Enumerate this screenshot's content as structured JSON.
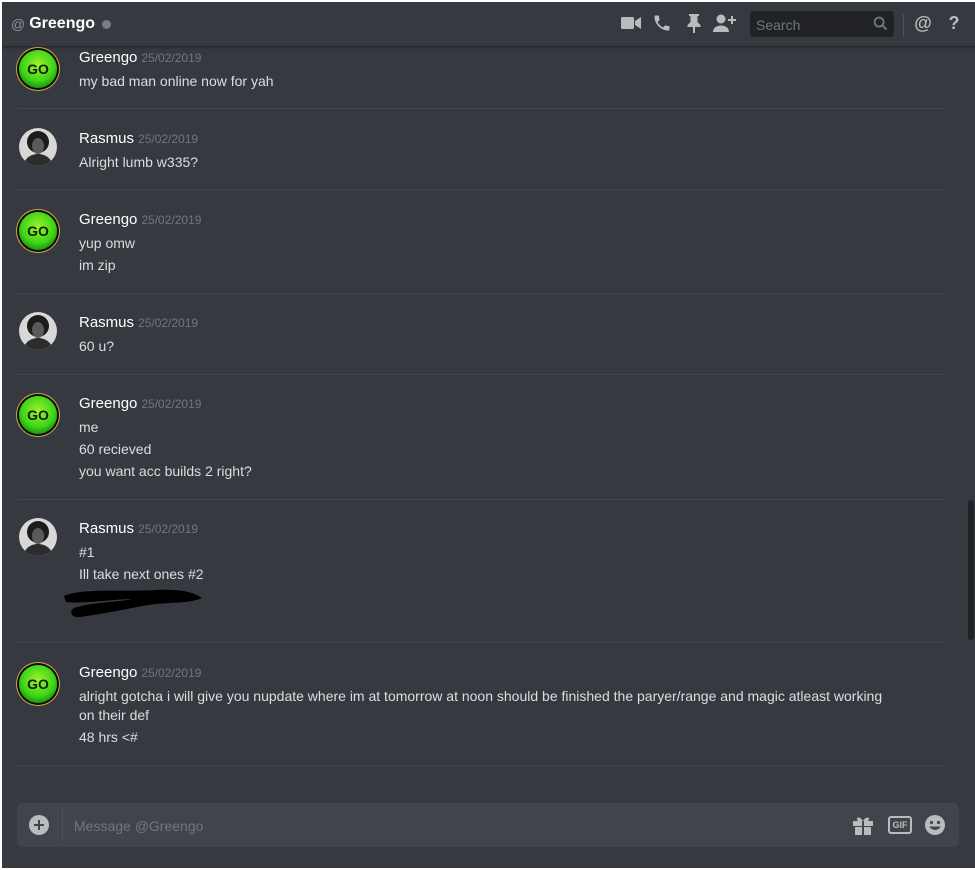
{
  "header": {
    "at": "@",
    "title": "Greengo",
    "search_placeholder": "Search",
    "mention_label": "@",
    "help_label": "?"
  },
  "messages": [
    {
      "author": "Greengo",
      "timestamp": "25/02/2019",
      "avatar": "go-icon",
      "avatar_text": "GO",
      "lines": [
        "my bad man online now for yah"
      ]
    },
    {
      "author": "Rasmus",
      "timestamp": "25/02/2019",
      "avatar": "portrait",
      "lines": [
        "Alright lumb w335?"
      ]
    },
    {
      "author": "Greengo",
      "timestamp": "25/02/2019",
      "avatar": "go-icon",
      "avatar_text": "GO",
      "lines": [
        "yup omw",
        "im zip"
      ]
    },
    {
      "author": "Rasmus",
      "timestamp": "25/02/2019",
      "avatar": "portrait",
      "lines": [
        "60 u?"
      ]
    },
    {
      "author": "Greengo",
      "timestamp": "25/02/2019",
      "avatar": "go-icon",
      "avatar_text": "GO",
      "lines": [
        "me",
        "60 recieved",
        "you want acc builds 2 right?"
      ]
    },
    {
      "author": "Rasmus",
      "timestamp": "25/02/2019",
      "avatar": "portrait",
      "lines": [
        "#1",
        "Ill take next ones #2"
      ]
    },
    {
      "author": "Greengo",
      "timestamp": "25/02/2019",
      "avatar": "go-icon",
      "avatar_text": "GO",
      "lines": [
        "alright gotcha i will give  you nupdate where im at tomorrow at noon should be finished the paryer/range and magic atleast working",
        "on their def",
        "48 hrs <#"
      ]
    }
  ],
  "composer": {
    "placeholder": "Message @Greengo",
    "gif_label": "GIF"
  },
  "colors": {
    "background": "#36393f",
    "composer": "#40444b",
    "username": "#ffffff",
    "timestamp": "#72767d",
    "text": "#dcddde"
  }
}
